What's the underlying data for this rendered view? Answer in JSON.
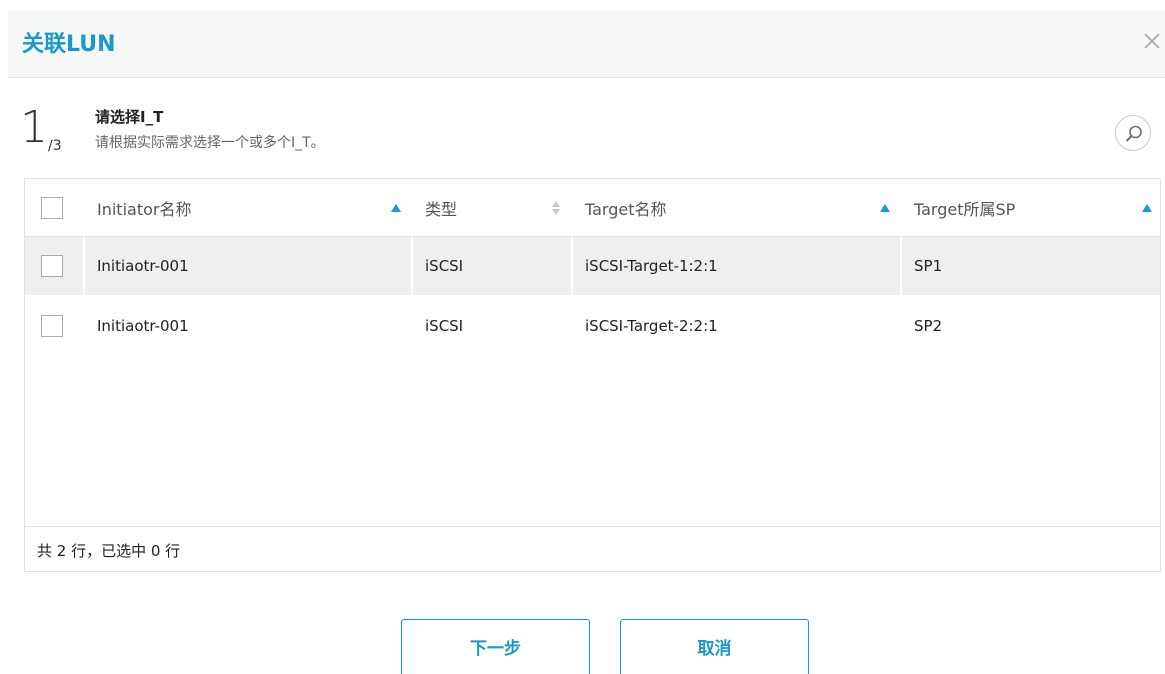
{
  "dialog": {
    "title": "关联LUN",
    "close_icon": "close-icon"
  },
  "step": {
    "current": "1",
    "total": "/3",
    "title": "请选择I_T",
    "description": "请根据实际需求选择一个或多个I_T。"
  },
  "search": {
    "icon": "search-icon"
  },
  "table": {
    "columns": [
      {
        "label": "Initiator名称",
        "sort": "ascending"
      },
      {
        "label": "类型",
        "sort": "sortable"
      },
      {
        "label": "Target名称",
        "sort": "ascending"
      },
      {
        "label": "Target所属SP",
        "sort": "ascending"
      }
    ],
    "rows": [
      {
        "initiator": "Initiaotr-001",
        "type": "iSCSI",
        "target": "iSCSI-Target-1:2:1",
        "sp": "SP1",
        "checked": false
      },
      {
        "initiator": "Initiaotr-001",
        "type": "iSCSI",
        "target": "iSCSI-Target-2:2:1",
        "sp": "SP2",
        "checked": false
      }
    ],
    "footer": "共 2 行，已选中 0 行"
  },
  "buttons": {
    "next": "下一步",
    "cancel": "取消"
  },
  "colors": {
    "accent": "#1a98c9",
    "header_bg": "#f6f7f7",
    "row_hover": "#efefef"
  }
}
